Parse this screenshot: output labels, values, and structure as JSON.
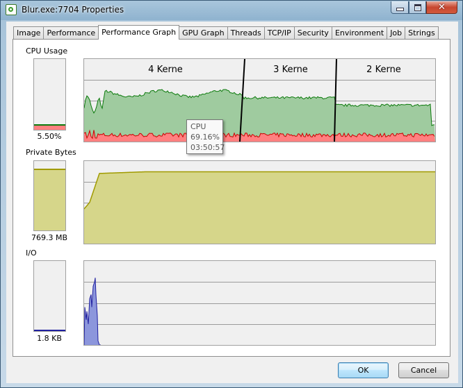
{
  "window": {
    "title": "Blur.exe:7704 Properties",
    "close_glyph": "✕"
  },
  "tabs": [
    {
      "label": "Image"
    },
    {
      "label": "Performance"
    },
    {
      "label": "Performance Graph",
      "active": true
    },
    {
      "label": "GPU Graph"
    },
    {
      "label": "Threads"
    },
    {
      "label": "TCP/IP"
    },
    {
      "label": "Security"
    },
    {
      "label": "Environment"
    },
    {
      "label": "Job"
    },
    {
      "label": "Strings"
    }
  ],
  "cpu": {
    "label": "CPU Usage",
    "value": "5.50%",
    "level": 0.055,
    "annotations": [
      "4 Kerne",
      "3 Kerne",
      "2 Kerne"
    ],
    "tooltip": {
      "title": "CPU",
      "value": "69.16%",
      "time": "03:50:57"
    }
  },
  "private_bytes": {
    "label": "Private Bytes",
    "value": "769.3 MB",
    "level": 0.87
  },
  "io": {
    "label": "I/O",
    "value": "1.8  KB",
    "level": 0.0
  },
  "buttons": {
    "ok": "OK",
    "cancel": "Cancel"
  },
  "colors": {
    "cpu_total_fill": "#9fcb9f",
    "cpu_total_line": "#0c7a0c",
    "cpu_kernel_fill": "#ff8080",
    "cpu_kernel_line": "#cc0000",
    "private_fill": "#d6d68a",
    "private_line": "#a09a00",
    "io_fill": "#8c96dc",
    "io_line": "#2020a0"
  }
}
